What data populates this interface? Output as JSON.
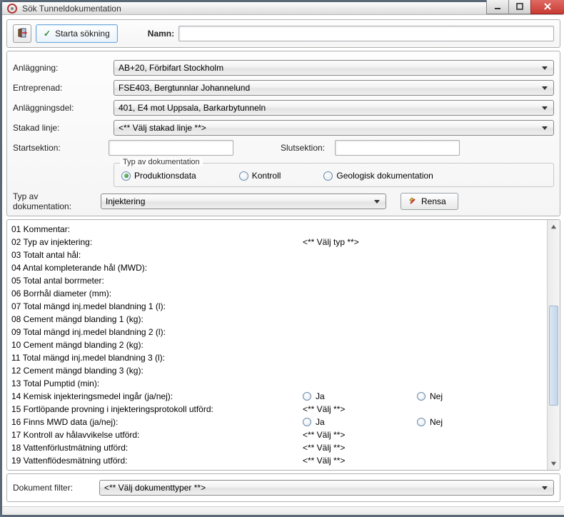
{
  "window": {
    "title": "Sök Tunneldokumentation"
  },
  "toolbar": {
    "exit_icon": "exit",
    "start_label": "Starta sökning",
    "name_label": "Namn:",
    "name_value": ""
  },
  "form": {
    "anlaggning_label": "Anläggning:",
    "anlaggning_value": "AB+20, Förbifart Stockholm",
    "entreprenad_label": "Entreprenad:",
    "entreprenad_value": "FSE403, Bergtunnlar Johannelund",
    "anlaggningsdel_label": "Anläggningsdel:",
    "anlaggningsdel_value": "401, E4 mot Uppsala, Barkarbytunneln",
    "stakad_linje_label": "Stakad linje:",
    "stakad_linje_value": "<** Välj stakad linje **>",
    "startsektion_label": "Startsektion:",
    "startsektion_value": "",
    "slutsektion_label": "Slutsektion:",
    "slutsektion_value": "",
    "doktype_group_label": "Typ av dokumentation",
    "radio_prod": "Produktionsdata",
    "radio_kontroll": "Kontroll",
    "radio_geologisk": "Geologisk dokumentation",
    "typ_dok_label": "Typ av dokumentation:",
    "typ_dok_value": "Injektering",
    "rensa_label": "Rensa"
  },
  "list": {
    "rows": [
      {
        "n": "01",
        "label": "Kommentar:"
      },
      {
        "n": "02",
        "label": "Typ av injektering:",
        "mid": "<** Välj typ **>"
      },
      {
        "n": "03",
        "label": "Totalt antal hål:"
      },
      {
        "n": "04",
        "label": "Antal kompleterande hål (MWD):"
      },
      {
        "n": "05",
        "label": "Total antal borrmeter:"
      },
      {
        "n": "06",
        "label": "Borrhål diameter (mm):"
      },
      {
        "n": "07",
        "label": "Total mängd inj.medel blandning 1 (l):"
      },
      {
        "n": "08",
        "label": "Cement mängd blanding 1 (kg):"
      },
      {
        "n": "09",
        "label": "Total mängd inj.medel blandning 2 (l):"
      },
      {
        "n": "10",
        "label": "Cement mängd blanding 2 (kg):"
      },
      {
        "n": "11",
        "label": "Total mängd inj.medel blandning 3 (l):"
      },
      {
        "n": "12",
        "label": "Cement mängd blanding 3 (kg):"
      },
      {
        "n": "13",
        "label": "Total Pumptid (min):"
      },
      {
        "n": "14",
        "label": "Kemisk injekteringsmedel ingår (ja/nej):",
        "opt1": "Ja",
        "opt2": "Nej"
      },
      {
        "n": "15",
        "label": "Fortlöpande provning i injekteringsprotokoll utförd:",
        "mid": "<** Välj **>"
      },
      {
        "n": "16",
        "label": "Finns MWD data (ja/nej):",
        "opt1": "Ja",
        "opt2": "Nej"
      },
      {
        "n": "17",
        "label": "Kontroll av hålavvikelse utförd:",
        "mid": "<** Välj **>"
      },
      {
        "n": "18",
        "label": "Vattenförlustmätning utförd:",
        "mid": "<** Välj **>"
      },
      {
        "n": "19",
        "label": "Vattenflödesmätning utförd:",
        "mid": "<** Välj **>"
      }
    ]
  },
  "footer": {
    "dokument_filter_label": "Dokument filter:",
    "dokument_filter_value": "<** Välj dokumenttyper **>"
  }
}
